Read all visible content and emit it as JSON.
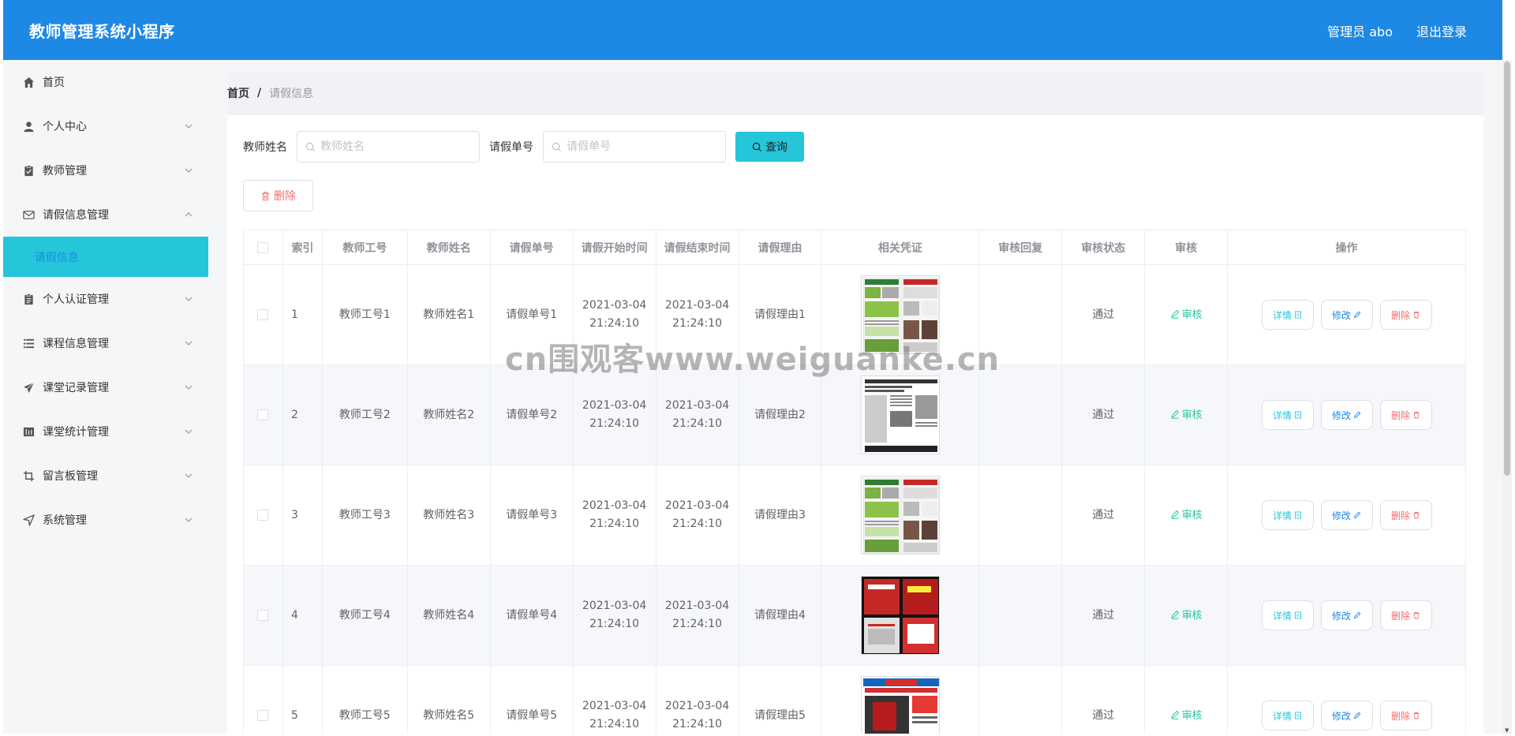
{
  "app": {
    "title": "教师管理系统小程序",
    "user_label": "管理员 abo",
    "logout_label": "退出登录"
  },
  "colors": {
    "header_bg": "#1e88e5",
    "accent": "#26c6da",
    "danger": "#f56c6c",
    "success": "#26c6a0"
  },
  "sidebar": {
    "items": [
      {
        "label": "首页",
        "icon": "home-icon"
      },
      {
        "label": "个人中心",
        "icon": "user-icon"
      },
      {
        "label": "教师管理",
        "icon": "clipboard-icon"
      },
      {
        "label": "请假信息管理",
        "icon": "mail-icon"
      },
      {
        "label": "个人认证管理",
        "icon": "clipboard-icon"
      },
      {
        "label": "课程信息管理",
        "icon": "list-icon"
      },
      {
        "label": "课堂记录管理",
        "icon": "send-icon"
      },
      {
        "label": "课堂统计管理",
        "icon": "chart-icon"
      },
      {
        "label": "留言板管理",
        "icon": "crop-icon"
      },
      {
        "label": "系统管理",
        "icon": "navigation-icon"
      }
    ],
    "active_sub": "请假信息"
  },
  "breadcrumb": {
    "home": "首页",
    "separator": "/",
    "current": "请假信息"
  },
  "search": {
    "teacher_name_label": "教师姓名",
    "teacher_name_placeholder": "教师姓名",
    "leave_no_label": "请假单号",
    "leave_no_placeholder": "请假单号",
    "query_label": "查询"
  },
  "toolbar": {
    "delete_label": "删除"
  },
  "table": {
    "headers": [
      "索引",
      "教师工号",
      "教师姓名",
      "请假单号",
      "请假开始时间",
      "请假结束时间",
      "请假理由",
      "相关凭证",
      "审核回复",
      "审核状态",
      "审核",
      "操作"
    ],
    "rows": [
      {
        "index": "1",
        "teacher_no": "教师工号1",
        "teacher_name": "教师姓名1",
        "leave_no": "请假单号1",
        "start_date": "2021-03-04",
        "start_time": "21:24:10",
        "end_date": "2021-03-04",
        "end_time": "21:24:10",
        "reason": "请假理由1",
        "reply": "",
        "status": "通过",
        "image": "newspaper-green-image"
      },
      {
        "index": "2",
        "teacher_no": "教师工号2",
        "teacher_name": "教师姓名2",
        "leave_no": "请假单号2",
        "start_date": "2021-03-04",
        "start_time": "21:24:10",
        "end_date": "2021-03-04",
        "end_time": "21:24:10",
        "reason": "请假理由2",
        "reply": "",
        "status": "通过",
        "image": "newspaper-english-image"
      },
      {
        "index": "3",
        "teacher_no": "教师工号3",
        "teacher_name": "教师姓名3",
        "leave_no": "请假单号3",
        "start_date": "2021-03-04",
        "start_time": "21:24:10",
        "end_date": "2021-03-04",
        "end_time": "21:24:10",
        "reason": "请假理由3",
        "reply": "",
        "status": "通过",
        "image": "newspaper-green-image"
      },
      {
        "index": "4",
        "teacher_no": "教师工号4",
        "teacher_name": "教师姓名4",
        "leave_no": "请假单号4",
        "start_date": "2021-03-04",
        "start_time": "21:24:10",
        "end_date": "2021-03-04",
        "end_time": "21:24:10",
        "reason": "请假理由4",
        "reply": "",
        "status": "通过",
        "image": "newspaper-red-image"
      },
      {
        "index": "5",
        "teacher_no": "教师工号5",
        "teacher_name": "教师姓名5",
        "leave_no": "请假单号5",
        "start_date": "2021-03-04",
        "start_time": "21:24:10",
        "end_date": "2021-03-04",
        "end_time": "21:24:10",
        "reason": "请假理由5",
        "reply": "",
        "status": "通过",
        "image": "newspaper-qingdao-image"
      }
    ],
    "audit_label": "审核",
    "detail_label": "详情",
    "edit_label": "修改",
    "delete_label": "删除"
  },
  "watermark": "cn围观客www.weiguanke.cn"
}
